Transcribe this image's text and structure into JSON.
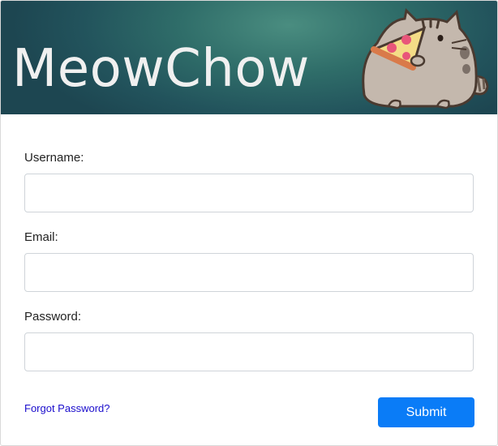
{
  "header": {
    "title": "MeowChow",
    "mascot_icon": "pusheen-cat-eating-pizza-icon"
  },
  "form": {
    "username_label": "Username:",
    "username_value": "",
    "email_label": "Email:",
    "email_value": "",
    "password_label": "Password:",
    "password_value": "",
    "forgot_link": "Forgot Password?",
    "submit_label": "Submit"
  },
  "colors": {
    "banner": "#2f6d69",
    "submit": "#0a7cf7",
    "link": "#1a0dcc"
  }
}
